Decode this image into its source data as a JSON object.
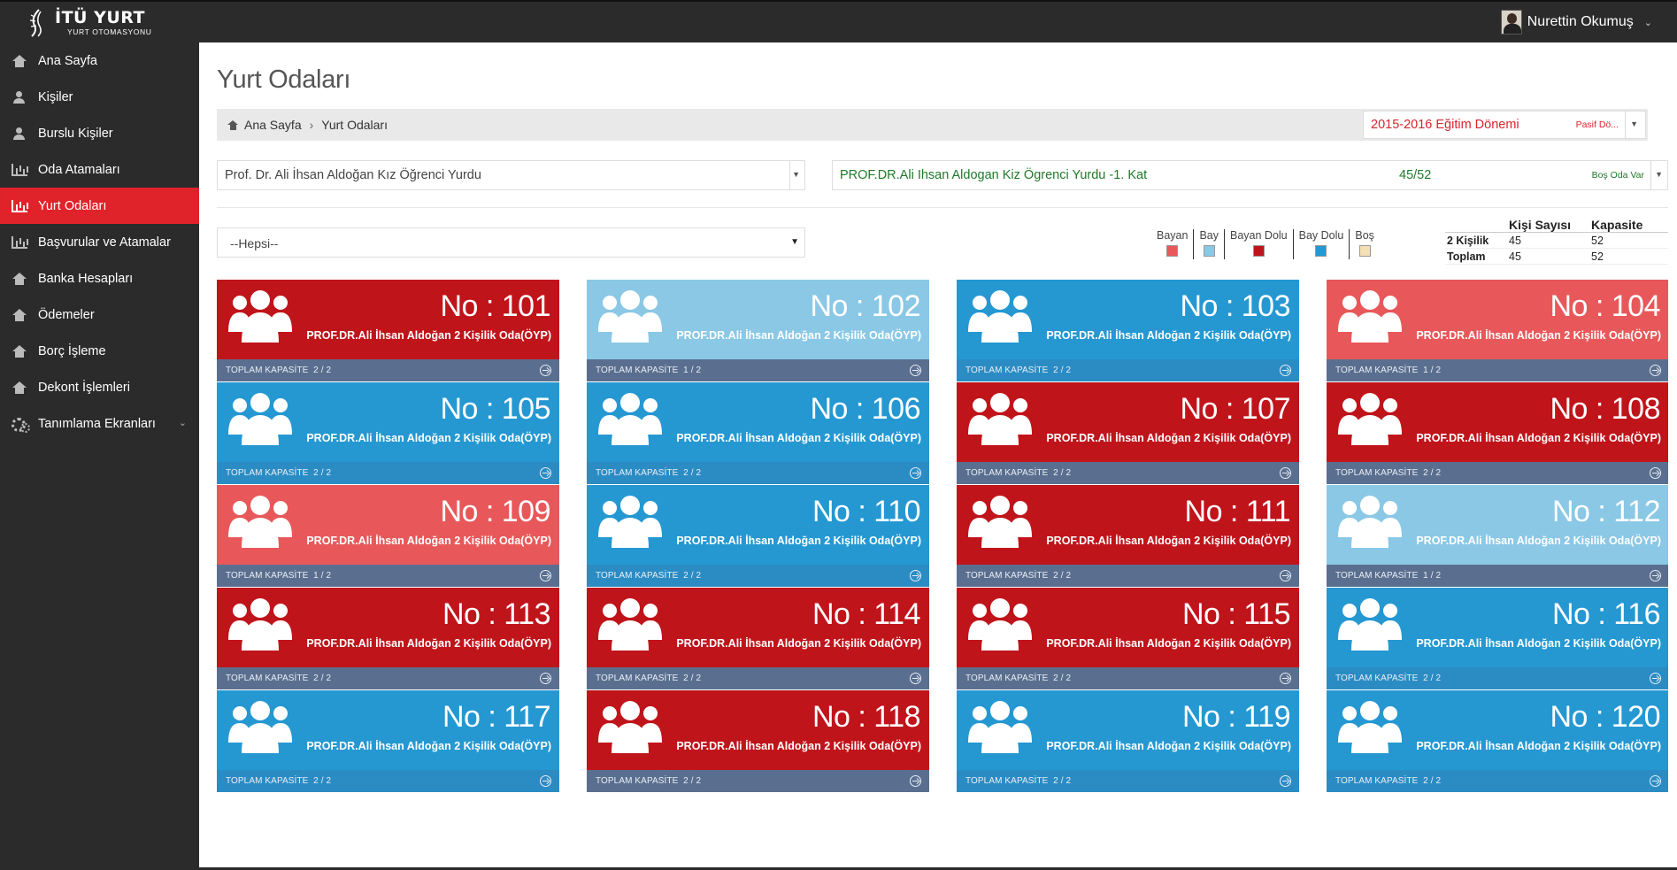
{
  "app": {
    "logo_title": "İTÜ YURT",
    "logo_sub": "YURT OTOMASYONU",
    "user_name": "Nurettin Okumuş"
  },
  "sidebar": {
    "items": [
      {
        "label": "Ana Sayfa",
        "icon": "home-icon",
        "active": false
      },
      {
        "label": "Kişiler",
        "icon": "user-icon",
        "active": false
      },
      {
        "label": "Burslu Kişiler",
        "icon": "user-icon",
        "active": false
      },
      {
        "label": "Oda Atamaları",
        "icon": "bar-chart-icon",
        "active": false
      },
      {
        "label": "Yurt Odaları",
        "icon": "bar-chart-icon",
        "active": true
      },
      {
        "label": "Başvurular ve Atamalar",
        "icon": "bar-chart-icon",
        "active": false
      },
      {
        "label": "Banka Hesapları",
        "icon": "home-icon",
        "active": false
      },
      {
        "label": "Ödemeler",
        "icon": "home-icon",
        "active": false
      },
      {
        "label": "Borç İşleme",
        "icon": "home-icon",
        "active": false
      },
      {
        "label": "Dekont İşlemleri",
        "icon": "home-icon",
        "active": false
      },
      {
        "label": "Tanımlama Ekranları",
        "icon": "gears-icon",
        "active": false,
        "has_submenu": true
      }
    ]
  },
  "page": {
    "title": "Yurt Odaları",
    "breadcrumb": [
      "Ana Sayfa",
      "Yurt Odaları"
    ]
  },
  "term": {
    "label": "2015-2016 Eğitim Dönemi",
    "status": "Pasif Dö..."
  },
  "dorm": {
    "selected": "Prof. Dr. Ali İhsan Aldoğan Kız Öğrenci Yurdu"
  },
  "floor": {
    "name": "PROF.DR.Ali Ihsan Aldogan Kiz Ögrenci Yurdu -1. Kat",
    "count": "45/52",
    "status": "Boş Oda Var"
  },
  "filter": {
    "selected": "--Hepsi--"
  },
  "legend": [
    {
      "label": "Bayan",
      "color": "#e8585a"
    },
    {
      "label": "Bay",
      "color": "#8ac8e6"
    },
    {
      "label": "Bayan Dolu",
      "color": "#c0141b"
    },
    {
      "label": "Bay Dolu",
      "color": "#2598d2"
    },
    {
      "label": "Boş",
      "color": "#f5dfb4"
    }
  ],
  "stats": {
    "headers": [
      "",
      "Kişi Sayısı",
      "Kapasite"
    ],
    "rows": [
      [
        "2 Kişilik",
        "45",
        "52"
      ],
      [
        "Toplam",
        "45",
        "52"
      ]
    ]
  },
  "room_type": "PROF.DR.Ali İhsan Aldoğan 2 Kişilik Oda(ÖYP)",
  "cap_label": "TOPLAM KAPASİTE",
  "colors": {
    "bayan": "#e8585a",
    "bay": "#8ac8e6",
    "bayan_dolu": "#c0141b",
    "bay_dolu": "#2598d2",
    "footer_normal": "#5a6f8f",
    "footer_bay_dolu": "#2b8cc4"
  },
  "rooms": [
    {
      "no": "No : 101",
      "cap": "2 / 2",
      "status": "bayan_dolu"
    },
    {
      "no": "No : 102",
      "cap": "1 / 2",
      "status": "bay"
    },
    {
      "no": "No : 103",
      "cap": "2 / 2",
      "status": "bay_dolu"
    },
    {
      "no": "No : 104",
      "cap": "1 / 2",
      "status": "bayan"
    },
    {
      "no": "No : 105",
      "cap": "2 / 2",
      "status": "bay_dolu"
    },
    {
      "no": "No : 106",
      "cap": "2 / 2",
      "status": "bay_dolu"
    },
    {
      "no": "No : 107",
      "cap": "2 / 2",
      "status": "bayan_dolu"
    },
    {
      "no": "No : 108",
      "cap": "2 / 2",
      "status": "bayan_dolu"
    },
    {
      "no": "No : 109",
      "cap": "1 / 2",
      "status": "bayan"
    },
    {
      "no": "No : 110",
      "cap": "2 / 2",
      "status": "bay_dolu"
    },
    {
      "no": "No : 111",
      "cap": "2 / 2",
      "status": "bayan_dolu"
    },
    {
      "no": "No : 112",
      "cap": "1 / 2",
      "status": "bay"
    },
    {
      "no": "No : 113",
      "cap": "2 / 2",
      "status": "bayan_dolu"
    },
    {
      "no": "No : 114",
      "cap": "2 / 2",
      "status": "bayan_dolu"
    },
    {
      "no": "No : 115",
      "cap": "2 / 2",
      "status": "bayan_dolu"
    },
    {
      "no": "No : 116",
      "cap": "2 / 2",
      "status": "bay_dolu"
    },
    {
      "no": "No : 117",
      "cap": "2 / 2",
      "status": "bay_dolu"
    },
    {
      "no": "No : 118",
      "cap": "2 / 2",
      "status": "bayan_dolu"
    },
    {
      "no": "No : 119",
      "cap": "2 / 2",
      "status": "bay_dolu"
    },
    {
      "no": "No : 120",
      "cap": "2 / 2",
      "status": "bay_dolu"
    }
  ]
}
